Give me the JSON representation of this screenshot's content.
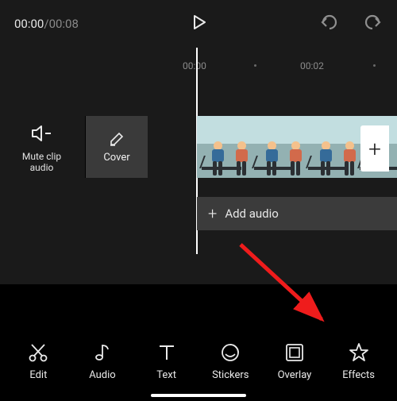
{
  "topbar": {
    "time_current": "00:00",
    "time_total": "00:08",
    "time_sep": "/"
  },
  "ruler": {
    "t0": "00:00",
    "t1": "00:02"
  },
  "side": {
    "mute_label": "Mute clip audio",
    "cover_label": "Cover"
  },
  "tracks": {
    "add_clip_glyph": "+",
    "add_audio_glyph": "+",
    "add_audio_label": "Add audio"
  },
  "tools": {
    "edit": "Edit",
    "audio": "Audio",
    "text": "Text",
    "stickers": "Stickers",
    "overlay": "Overlay",
    "effects": "Effects"
  }
}
